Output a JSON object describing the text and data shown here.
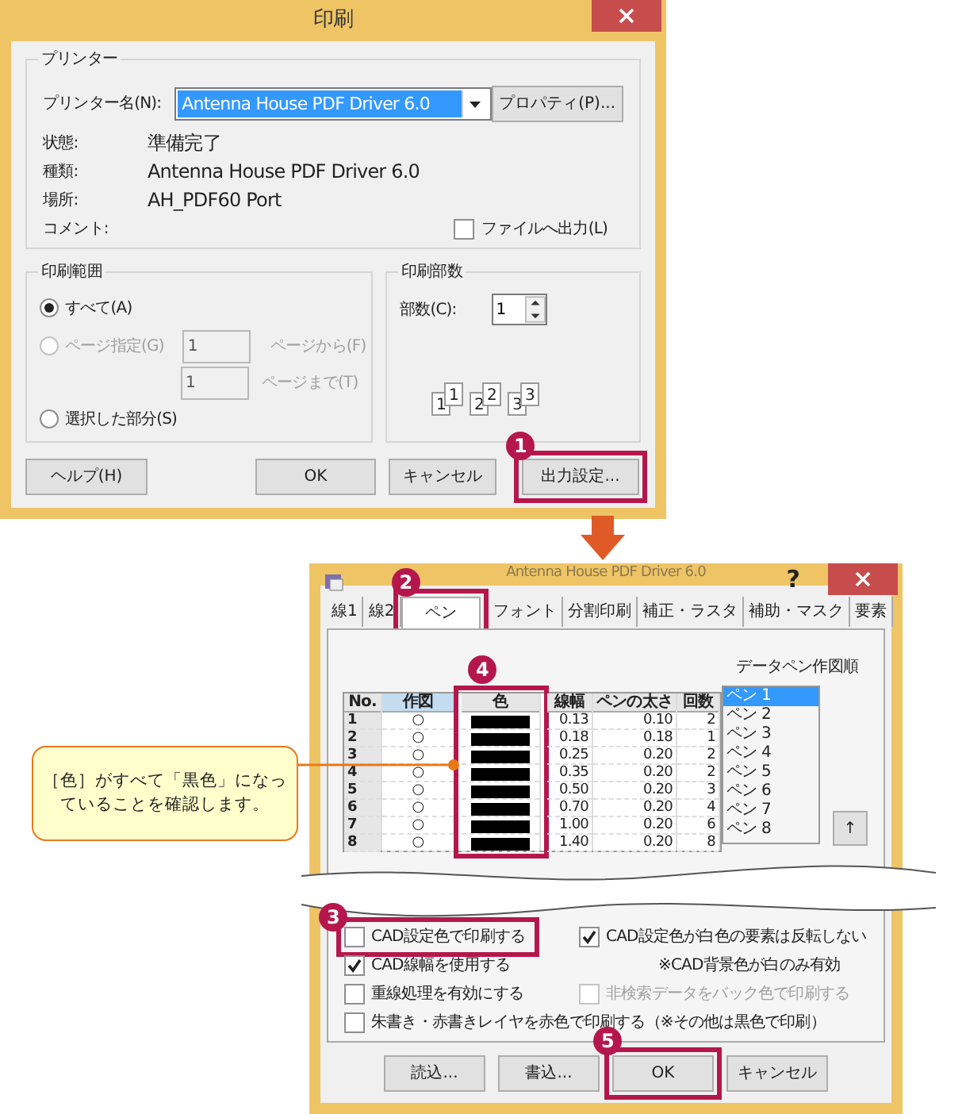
{
  "print_dialog": {
    "title": "印刷",
    "printer_group": {
      "title": "プリンター",
      "name_label": "プリンター名(N):",
      "name_value": "Antenna House PDF Driver 6.0",
      "properties_button": "プロパティ(P)...",
      "info": [
        {
          "label": "状態:",
          "value": "準備完了"
        },
        {
          "label": "種類:",
          "value": "Antenna House PDF Driver 6.0"
        },
        {
          "label": "場所:",
          "value": "AH_PDF60 Port"
        },
        {
          "label": "コメント:"
        }
      ],
      "file_output": {
        "label": "ファイルへ出力(L)",
        "checked": false
      }
    },
    "range_group": {
      "title": "印刷範囲",
      "options": [
        {
          "label": "すべて(A)",
          "selected": true,
          "disabled": false
        },
        {
          "label": "ページ指定(G)",
          "selected": false,
          "disabled": true
        },
        {
          "label": "選択した部分(S)",
          "selected": false,
          "disabled": false
        }
      ],
      "from": {
        "value": "1",
        "label": "ページから(F)"
      },
      "to": {
        "value": "1",
        "label": "ページまで(T)"
      }
    },
    "copies_group": {
      "title": "印刷部数",
      "label": "部数(C):",
      "value": "1",
      "pages": [
        "1",
        "1",
        "2",
        "2",
        "3",
        "3"
      ]
    },
    "buttons": [
      {
        "label": "ヘルプ(H)"
      },
      {
        "label": "OK"
      },
      {
        "label": "キャンセル"
      },
      {
        "label": "出力設定...",
        "step": "1"
      }
    ]
  },
  "settings_dialog": {
    "title": "Antenna House PDF Driver 6.0",
    "help": "?",
    "tabs": [
      {
        "label": "線1",
        "selected": false
      },
      {
        "label": "線2",
        "selected": false
      },
      {
        "label": "ペン",
        "selected": true,
        "step": "2"
      },
      {
        "label": "フォント",
        "selected": false
      },
      {
        "label": "分割印刷",
        "selected": false
      },
      {
        "label": "補正・ラスタ",
        "selected": false
      },
      {
        "label": "補助・マスク",
        "selected": false
      },
      {
        "label": "要素",
        "selected": false
      }
    ],
    "order_label": "データペン作図順",
    "table": {
      "columns": [
        {
          "label": "No.",
          "kind": "number",
          "selected": false
        },
        {
          "label": "作図",
          "kind": "mark",
          "selected": true
        },
        {
          "label": "色",
          "kind": "swatch",
          "selected": false,
          "step": "4"
        },
        {
          "label": "線幅",
          "kind": "text",
          "selected": false
        },
        {
          "label": "ペンの太さ",
          "kind": "text",
          "selected": false
        },
        {
          "label": "回数",
          "kind": "text",
          "selected": false
        }
      ],
      "rows": [
        {
          "cells": [
            "1",
            "○",
            "",
            "0.13",
            "0.10",
            "2"
          ],
          "color": "#000000"
        },
        {
          "cells": [
            "2",
            "○",
            "",
            "0.18",
            "0.18",
            "1"
          ],
          "color": "#000000"
        },
        {
          "cells": [
            "3",
            "○",
            "",
            "0.25",
            "0.20",
            "2"
          ],
          "color": "#000000"
        },
        {
          "cells": [
            "4",
            "○",
            "",
            "0.35",
            "0.20",
            "2"
          ],
          "color": "#000000"
        },
        {
          "cells": [
            "5",
            "○",
            "",
            "0.50",
            "0.20",
            "3"
          ],
          "color": "#000000"
        },
        {
          "cells": [
            "6",
            "○",
            "",
            "0.70",
            "0.20",
            "4"
          ],
          "color": "#000000"
        },
        {
          "cells": [
            "7",
            "○",
            "",
            "1.00",
            "0.20",
            "6"
          ],
          "color": "#000000"
        },
        {
          "cells": [
            "8",
            "○",
            "",
            "1.40",
            "0.20",
            "8"
          ],
          "color": "#000000"
        }
      ]
    },
    "pen_list": [
      {
        "label": "ペン 1",
        "selected": true
      },
      {
        "label": "ペン 2",
        "selected": false
      },
      {
        "label": "ペン 3",
        "selected": false
      },
      {
        "label": "ペン 4",
        "selected": false
      },
      {
        "label": "ペン 5",
        "selected": false
      },
      {
        "label": "ペン 6",
        "selected": false
      },
      {
        "label": "ペン 7",
        "selected": false
      },
      {
        "label": "ペン 8",
        "selected": false
      }
    ],
    "up_button": "↑",
    "options": [
      {
        "kind": "checkbox",
        "label": "CAD設定色で印刷する",
        "checked": false,
        "disabled": false,
        "step": "3"
      },
      {
        "kind": "checkbox",
        "label": "CAD設定色が白色の要素は反転しない",
        "checked": true,
        "disabled": false
      },
      {
        "kind": "checkbox",
        "label": "CAD線幅を使用する",
        "checked": true,
        "disabled": false
      },
      {
        "kind": "note",
        "label": "※CAD背景色が白のみ有効"
      },
      {
        "kind": "checkbox",
        "label": "重線処理を有効にする",
        "checked": false,
        "disabled": false
      },
      {
        "kind": "checkbox",
        "label": "非検索データをバック色で印刷する",
        "checked": false,
        "disabled": true
      },
      {
        "kind": "wide",
        "label": "朱書き・赤書きレイヤを赤色で印刷する（※その他は黒色で印刷）",
        "checked": false,
        "disabled": false
      }
    ],
    "buttons": [
      {
        "label": "読込..."
      },
      {
        "label": "書込..."
      },
      {
        "label": "OK",
        "step": "5"
      },
      {
        "label": "キャンセル"
      }
    ]
  },
  "callout": "［色］がすべて「黒色」になっていることを確認します。"
}
